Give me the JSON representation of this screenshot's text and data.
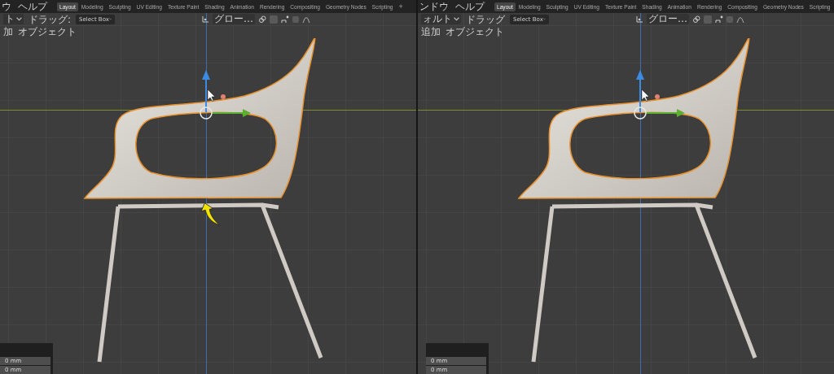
{
  "panels": [
    {
      "menu": [
        "ウ",
        "ヘルプ"
      ],
      "tabs": [
        {
          "label": "Layout",
          "selected": true
        },
        {
          "label": "Modeling",
          "selected": false
        },
        {
          "label": "Sculpting",
          "selected": false
        },
        {
          "label": "UV Editing",
          "selected": false
        },
        {
          "label": "Texture Paint",
          "selected": false
        },
        {
          "label": "Shading",
          "selected": false
        },
        {
          "label": "Animation",
          "selected": false
        },
        {
          "label": "Rendering",
          "selected": false
        },
        {
          "label": "Compositing",
          "selected": false
        },
        {
          "label": "Geometry Nodes",
          "selected": false
        },
        {
          "label": "Scripting",
          "selected": false
        }
      ],
      "add_tab": "+",
      "mode": "ト",
      "drag_label": "ドラッグ:",
      "select_tool": "Select Box",
      "orientation": "グロー…",
      "add_menu": "加",
      "object_menu": "オブジェクト",
      "annotation_arrow": true,
      "fields": [
        "0 mm",
        "0 mm"
      ]
    },
    {
      "menu": [
        "ンドウ",
        "ヘルプ"
      ],
      "tabs": [
        {
          "label": "Layout",
          "selected": true
        },
        {
          "label": "Modeling",
          "selected": false
        },
        {
          "label": "Sculpting",
          "selected": false
        },
        {
          "label": "UV Editing",
          "selected": false
        },
        {
          "label": "Texture Paint",
          "selected": false
        },
        {
          "label": "Shading",
          "selected": false
        },
        {
          "label": "Animation",
          "selected": false
        },
        {
          "label": "Rendering",
          "selected": false
        },
        {
          "label": "Compositing",
          "selected": false
        },
        {
          "label": "Geometry Nodes",
          "selected": false
        },
        {
          "label": "Scripting",
          "selected": false
        }
      ],
      "mode": "ォルト",
      "drag_label": "ドラッグ",
      "select_tool": "Select Box",
      "orientation": "グロー…",
      "add_menu": "追加",
      "object_menu": "オブジェクト",
      "annotation_arrow": false,
      "fields": [
        "0 mm",
        "0 mm"
      ]
    }
  ]
}
